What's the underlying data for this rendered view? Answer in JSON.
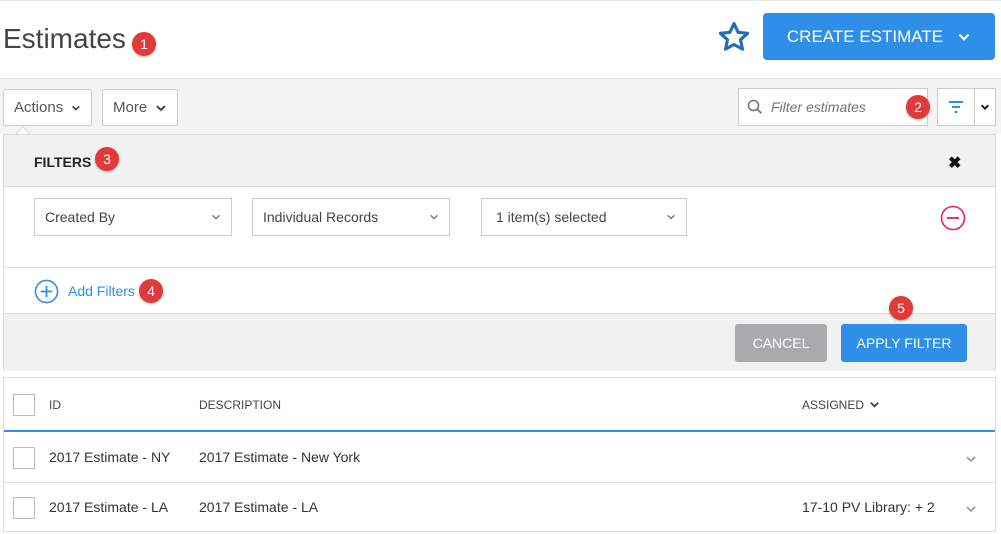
{
  "header": {
    "title": "Estimates",
    "create_label": "CREATE ESTIMATE"
  },
  "toolbar": {
    "actions_label": "Actions",
    "more_label": "More",
    "search_placeholder": "Filter estimates"
  },
  "filters": {
    "title": "FILTERS",
    "close_glyph": "✖",
    "field": "Created By",
    "mode": "Individual Records",
    "selection": "1 item(s) selected",
    "add_label": "Add Filters",
    "cancel_label": "CANCEL",
    "apply_label": "APPLY FILTER"
  },
  "table": {
    "columns": [
      "ID",
      "DESCRIPTION",
      "ASSIGNED"
    ],
    "rows": [
      {
        "id": "2017 Estimate - NY",
        "description": "2017 Estimate - New York",
        "assigned": ""
      },
      {
        "id": "2017 Estimate - LA",
        "description": "2017 Estimate - LA",
        "assigned": "17-10 PV Library: + 2"
      }
    ]
  },
  "badges": [
    "1",
    "2",
    "3",
    "4",
    "5"
  ],
  "colors": {
    "accent": "#2f8ee8",
    "badge": "#e03a3a",
    "remove": "#e0245e",
    "cancel": "#a9aaac"
  },
  "icons": [
    "star-icon",
    "chevron-down-icon",
    "search-icon",
    "filter-icon",
    "close-icon",
    "remove-circle-icon",
    "add-circle-icon"
  ]
}
